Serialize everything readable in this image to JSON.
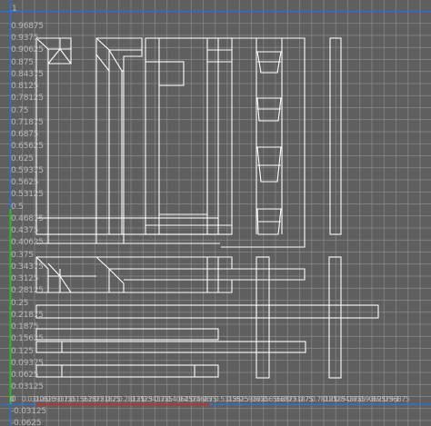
{
  "editor": {
    "name": "UV Texture Editor",
    "colors": {
      "background": "#5f5f5f",
      "grid": "#8a8a8a",
      "uv_axis": "#2f6fd6",
      "u_axis_red": "#c03030",
      "v_axis_green": "#22c022",
      "uv_shell": "#ffffff",
      "tick_label": "#b8b8b8"
    },
    "v_labels": [
      "1",
      "0.96875",
      "0.9375",
      "0.90625",
      "0.875",
      "0.84375",
      "0.8125",
      "0.78125",
      "0.75",
      "0.71875",
      "0.6875",
      "0.65625",
      "0.625",
      "0.59375",
      "0.5625",
      "0.53125",
      "0.5",
      "0.46875",
      "0.4375",
      "0.40625",
      "0.375",
      "0.34375",
      "0.3125",
      "0.28125",
      "0.25",
      "0.21875",
      "0.1875",
      "0.15625",
      "0.125",
      "0.09375",
      "0.0625",
      "0.03125",
      "0",
      "-0.03125",
      "-0.0625"
    ],
    "u_labels": [
      "0",
      "0.03125",
      "0.0625",
      "0.09375",
      "0.125",
      "0.15625",
      "0.1875",
      "0.21875",
      "0.25",
      "0.28125",
      "0.3125",
      "0.34375",
      "0.375",
      "0.40625",
      "0.4375",
      "0.46875",
      "0.5",
      "0.53125",
      "0.5625",
      "0.59375",
      "0.625",
      "0.65625",
      "0.6875",
      "0.71875",
      "0.75",
      "0.78125",
      "0.8125",
      "0.84375",
      "0.875",
      "0.90625",
      "0.9375",
      "0.96875",
      "1"
    ]
  }
}
